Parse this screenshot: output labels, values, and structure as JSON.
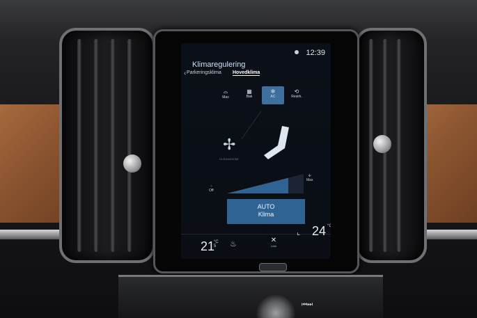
{
  "header": {
    "title": "Klimaregulering",
    "time": "12:39"
  },
  "tabs": [
    {
      "label": "Parkeringsklima"
    },
    {
      "label": "Hovedklima"
    }
  ],
  "quick_buttons": [
    {
      "label": "Max",
      "icon": "front-defrost-icon"
    },
    {
      "label": "Bak",
      "icon": "rear-defrost-icon"
    },
    {
      "label": "AC",
      "icon": "snowflake-icon"
    },
    {
      "label": "Resirk.",
      "icon": "recirculation-icon"
    }
  ],
  "fan": {
    "cleanzone_label": "CLEANZONE",
    "off_label": "Off",
    "max_label": "Max",
    "level_fraction": 0.8
  },
  "auto_button": {
    "line1": "AUTO",
    "line2": "Klima"
  },
  "bottom": {
    "temp_left": "21",
    "temp_left_unit": "°C",
    "temp_left_decimal": "5",
    "temp_right": "24",
    "temp_right_unit": "°C",
    "close_label": "Lukk"
  },
  "colors": {
    "accent": "#3f6f9d",
    "auto_button": "#2f6394",
    "screen_bg": "#0b1018",
    "leather": "#a86a3e"
  }
}
